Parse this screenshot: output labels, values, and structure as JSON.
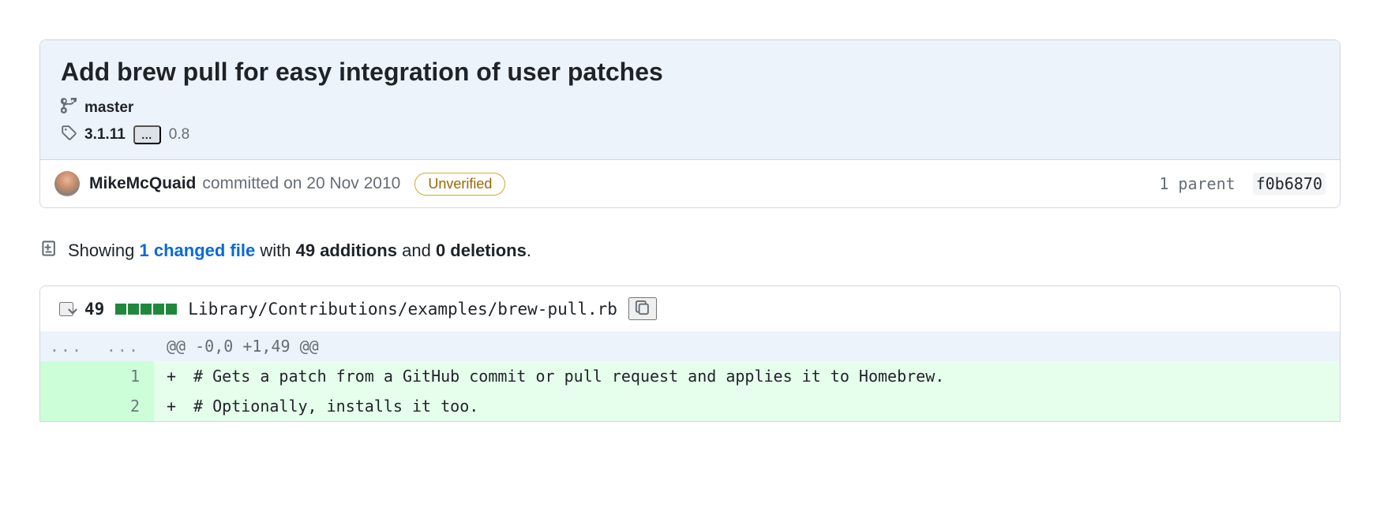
{
  "commit": {
    "title": "Add brew pull for easy integration of user patches",
    "branch": "master",
    "tag_first": "3.1.11",
    "tag_ellipsis": "…",
    "tag_last": "0.8",
    "author": "MikeMcQuaid",
    "action_text": "committed on 20 Nov 2010",
    "verification": "Unverified",
    "parent_label": "1 parent",
    "parent_sha": "f0b6870"
  },
  "summary": {
    "prefix": "Showing",
    "changed_files": "1 changed file",
    "mid1": "with",
    "additions": "49 additions",
    "mid2": "and",
    "deletions": "0 deletions",
    "suffix": "."
  },
  "file": {
    "change_count": "49",
    "path": "Library/Contributions/examples/brew-pull.rb",
    "hunk": "@@ -0,0 +1,49 @@",
    "lines": [
      {
        "old": "",
        "new": "1",
        "sign": "+",
        "text": " # Gets a patch from a GitHub commit or pull request and applies it to Homebrew."
      },
      {
        "old": "",
        "new": "2",
        "sign": "+",
        "text": " # Optionally, installs it too."
      }
    ]
  },
  "icons": {
    "branch": "git-branch-icon",
    "tag": "tag-icon",
    "diff": "file-diff-icon",
    "chevron": "chevron-down-icon",
    "copy": "copy-icon"
  }
}
